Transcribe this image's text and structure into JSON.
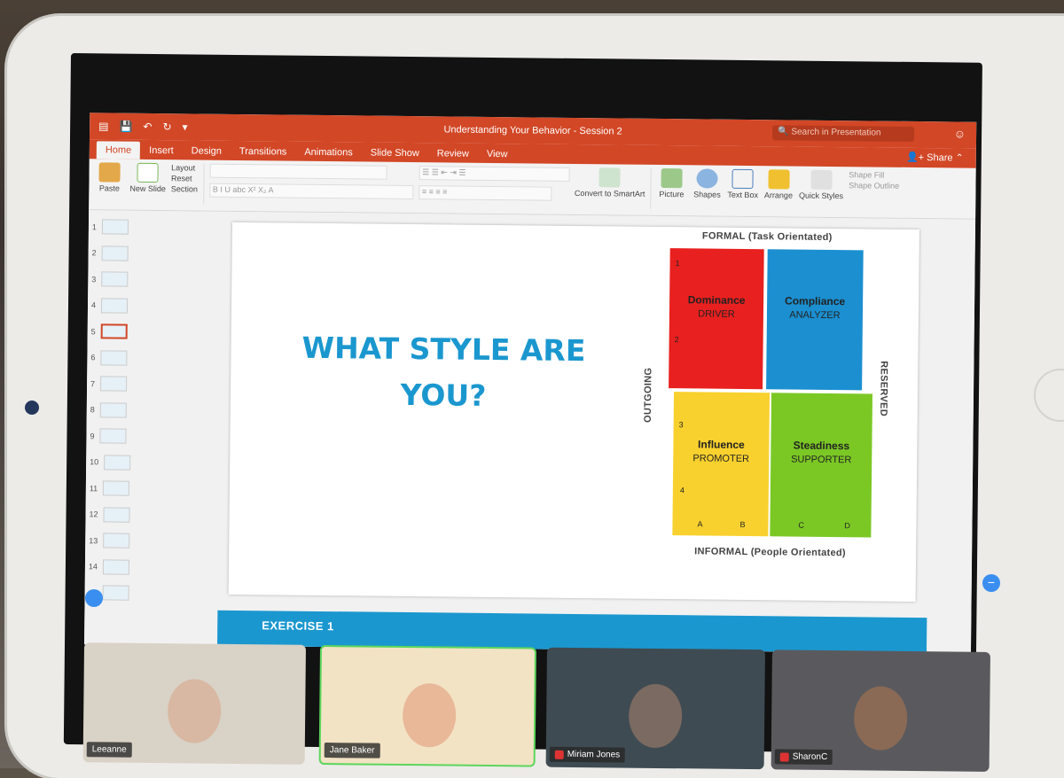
{
  "window": {
    "title": "Understanding Your Behavior - Session 2",
    "search_placeholder": "Search in Presentation"
  },
  "tabs": [
    "Home",
    "Insert",
    "Design",
    "Transitions",
    "Animations",
    "Slide Show",
    "Review",
    "View"
  ],
  "share_label": "Share",
  "ribbon": {
    "paste": "Paste",
    "new_slide": "New Slide",
    "layout": "Layout",
    "reset": "Reset",
    "section": "Section",
    "convert": "Convert to SmartArt",
    "picture": "Picture",
    "shapes": "Shapes",
    "text_box": "Text Box",
    "arrange": "Arrange",
    "quick_styles": "Quick Styles",
    "shape_fill": "Shape Fill",
    "shape_outline": "Shape Outline"
  },
  "thumbnails": [
    "1",
    "2",
    "3",
    "4",
    "5",
    "6",
    "7",
    "8",
    "9",
    "10",
    "11",
    "12",
    "13",
    "14",
    "15"
  ],
  "selected_slide": "5",
  "slide": {
    "title": "WHAT STYLE ARE YOU?",
    "top_axis": "FORMAL (Task Orientated)",
    "bottom_axis": "INFORMAL (People Orientated)",
    "left_axis": "OUTGOING",
    "right_axis": "RESERVED",
    "quadrants": [
      {
        "title": "Dominance",
        "sub": "DRIVER",
        "color": "#e8201f"
      },
      {
        "title": "Compliance",
        "sub": "ANALYZER",
        "color": "#1b8fd0"
      },
      {
        "title": "Influence",
        "sub": "PROMOTER",
        "color": "#f9d12e"
      },
      {
        "title": "Steadiness",
        "sub": "SUPPORTER",
        "color": "#7bc825"
      }
    ],
    "row_nums": [
      "1",
      "2",
      "3",
      "4"
    ],
    "col_letters": [
      "A",
      "B",
      "C",
      "D"
    ],
    "exercise": "EXERCISE 1"
  },
  "participants": [
    "Leeanne",
    "Jane Baker",
    "Miriam Jones",
    "SharonC"
  ]
}
